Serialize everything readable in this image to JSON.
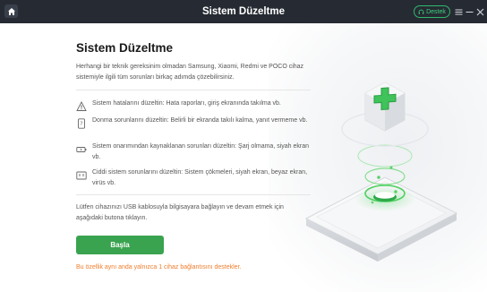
{
  "window": {
    "title": "Sistem Düzeltme",
    "support_label": "Destek",
    "home_icon": "home-icon",
    "menu_icon": "hamburger-menu-icon",
    "minimize_icon": "minimize-icon",
    "close_icon": "close-icon"
  },
  "main": {
    "heading": "Sistem Düzeltme",
    "description": "Herhangi bir teknik gereksinim olmadan Samsung, Xiaomi, Redmi ve POCO cihaz sistemiyle ilgili tüm sorunları birkaç adımda çözebilirsiniz.",
    "features": [
      {
        "icon": "warning-icon",
        "text": "Sistem hatalarını düzeltin: Hata raporları, giriş ekranında takılma vb."
      },
      {
        "icon": "phone-question-icon",
        "text": "Donma sorunlarını düzeltin: Belirli bir ekranda takılı kalma, yanıt vermeme vb."
      },
      {
        "icon": "battery-icon",
        "text": "Sistem onarımından kaynaklanan sorunları düzeltin: Şarj olmama, siyah ekran vb."
      },
      {
        "icon": "broken-screen-icon",
        "text": "Ciddi sistem sorunlarını düzeltin: Sistem çökmeleri, siyah ekran, beyaz ekran, virüs vb."
      }
    ],
    "connect_text": "Lütfen cihazınızı USB kablosuyla bilgisayara bağlayın ve devam etmek için aşağıdaki butona tıklayın.",
    "start_button": "Başla",
    "note": "Bu özellik aynı anda yalnızca 1 cihaz bağlantısını destekler."
  },
  "illustration": {
    "name": "phone-repair-illustration",
    "plus_icon": "green-plus-icon",
    "accent": "#3aa34f"
  },
  "colors": {
    "titlebar": "#262b33",
    "accent_green": "#3aa34f",
    "note_orange": "#ef7d2c"
  }
}
